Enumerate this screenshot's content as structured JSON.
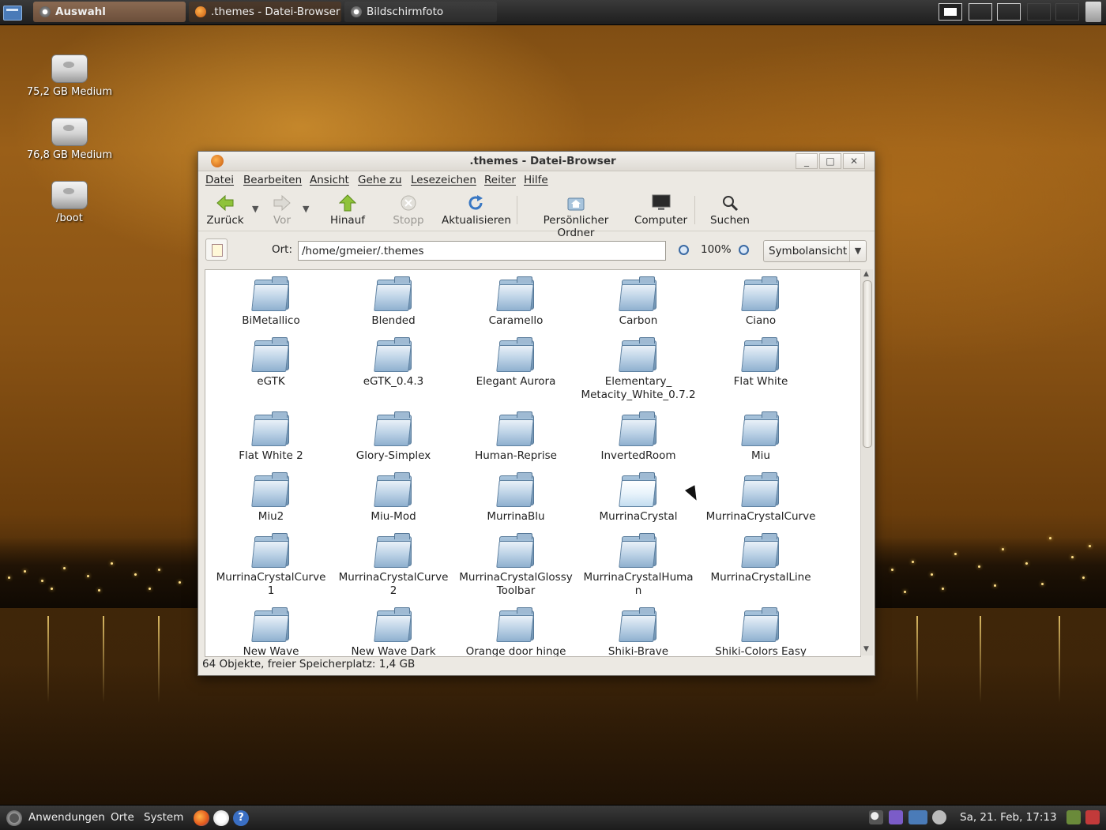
{
  "top_panel": {
    "tasks": [
      {
        "label": "Auswahl",
        "icon": "screenshot-app-icon"
      },
      {
        "label": ".themes - Datei-Browser",
        "icon": "file-browser-icon"
      },
      {
        "label": "Bildschirmfoto",
        "icon": "screenshot-app-icon"
      }
    ]
  },
  "desktop": {
    "icons": [
      {
        "label": "75,2 GB Medium",
        "icon": "drive-icon"
      },
      {
        "label": "76,8 GB Medium",
        "icon": "drive-icon"
      },
      {
        "label": "/boot",
        "icon": "drive-icon"
      }
    ]
  },
  "window": {
    "title": ".themes - Datei-Browser",
    "menu": [
      "Datei",
      "Bearbeiten",
      "Ansicht",
      "Gehe zu",
      "Lesezeichen",
      "Reiter",
      "Hilfe"
    ],
    "toolbar": {
      "back": "Zurück",
      "forward": "Vor",
      "up": "Hinauf",
      "stop": "Stopp",
      "reload": "Aktualisieren",
      "home": "Persönlicher Ordner",
      "computer": "Computer",
      "search": "Suchen"
    },
    "location": {
      "label": "Ort:",
      "path": "/home/gmeier/.themes",
      "zoom": "100%",
      "view_mode": "Symbolansicht"
    },
    "folders": [
      [
        "BiMetallico",
        "Blended",
        "Caramello",
        "Carbon",
        "Ciano"
      ],
      [
        "eGTK",
        "eGTK_0.4.3",
        "Elegant Aurora",
        "Elementary_ Metacity_White_0.7.2",
        "Flat White"
      ],
      [
        "Flat White 2",
        "Glory-Simplex",
        "Human-Reprise",
        "InvertedRoom",
        "Miu"
      ],
      [
        "Miu2",
        "Miu-Mod",
        "MurrinaBlu",
        "MurrinaCrystal",
        "MurrinaCrystalCurve"
      ],
      [
        "MurrinaCrystalCurve 1",
        "MurrinaCrystalCurve 2",
        "MurrinaCrystalGlossy Toolbar",
        "MurrinaCrystalHuma n",
        "MurrinaCrystalLine"
      ],
      [
        "New Wave",
        "New Wave Dark",
        "Orange door hinge",
        "Shiki-Brave",
        "Shiki-Colors Easy"
      ]
    ],
    "status": "64 Objekte, freier Speicherplatz: 1,4 GB"
  },
  "bottom_panel": {
    "menus": [
      "Anwendungen",
      "Orte",
      "System"
    ],
    "clock": "Sa, 21. Feb, 17:13"
  }
}
